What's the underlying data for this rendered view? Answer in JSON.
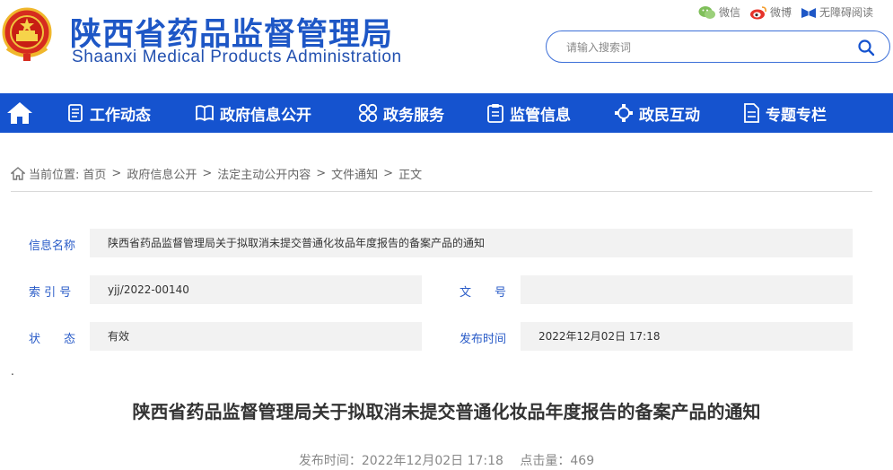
{
  "header": {
    "site_name_cn": "陕西省药品监督管理局",
    "site_name_en": "Shaanxi Medical Products Administration",
    "top_links": [
      {
        "label": "微信",
        "icon": "wechat-icon"
      },
      {
        "label": "微博",
        "icon": "weibo-icon"
      },
      {
        "label": "无障碍阅读",
        "icon": "accessibility-icon"
      }
    ],
    "search_placeholder": "请输入搜索词"
  },
  "nav": {
    "items": [
      {
        "label": "工作动态",
        "icon": "list-icon"
      },
      {
        "label": "政府信息公开",
        "icon": "book-icon"
      },
      {
        "label": "政务服务",
        "icon": "grid-icon"
      },
      {
        "label": "监管信息",
        "icon": "clipboard-icon"
      },
      {
        "label": "政民互动",
        "icon": "interaction-icon"
      },
      {
        "label": "专题专栏",
        "icon": "document-icon"
      }
    ],
    "color": "#1553cf"
  },
  "breadcrumb": {
    "prefix": "当前位置:",
    "items": [
      "首页",
      "政府信息公开",
      "法定主动公开内容",
      "文件通知",
      "正文"
    ]
  },
  "info": {
    "name_label": "信息名称",
    "name_value": "陕西省药品监督管理局关于拟取消未提交普通化妆品年度报告的备案产品的通知",
    "index_label": "索 引 号",
    "index_value": "yjj/2022-00140",
    "docno_label": "文　　号",
    "docno_value": "",
    "status_label": "状　　态",
    "status_value": "有效",
    "pubtime_label": "发布时间",
    "pubtime_value": "2022年12月02日 17:18"
  },
  "article": {
    "dot": ".",
    "title": "陕西省药品监督管理局关于拟取消未提交普通化妆品年度报告的备案产品的通知",
    "publish_time": "发布时间：2022年12月02日 17:18",
    "clicks": "点击量：469"
  }
}
